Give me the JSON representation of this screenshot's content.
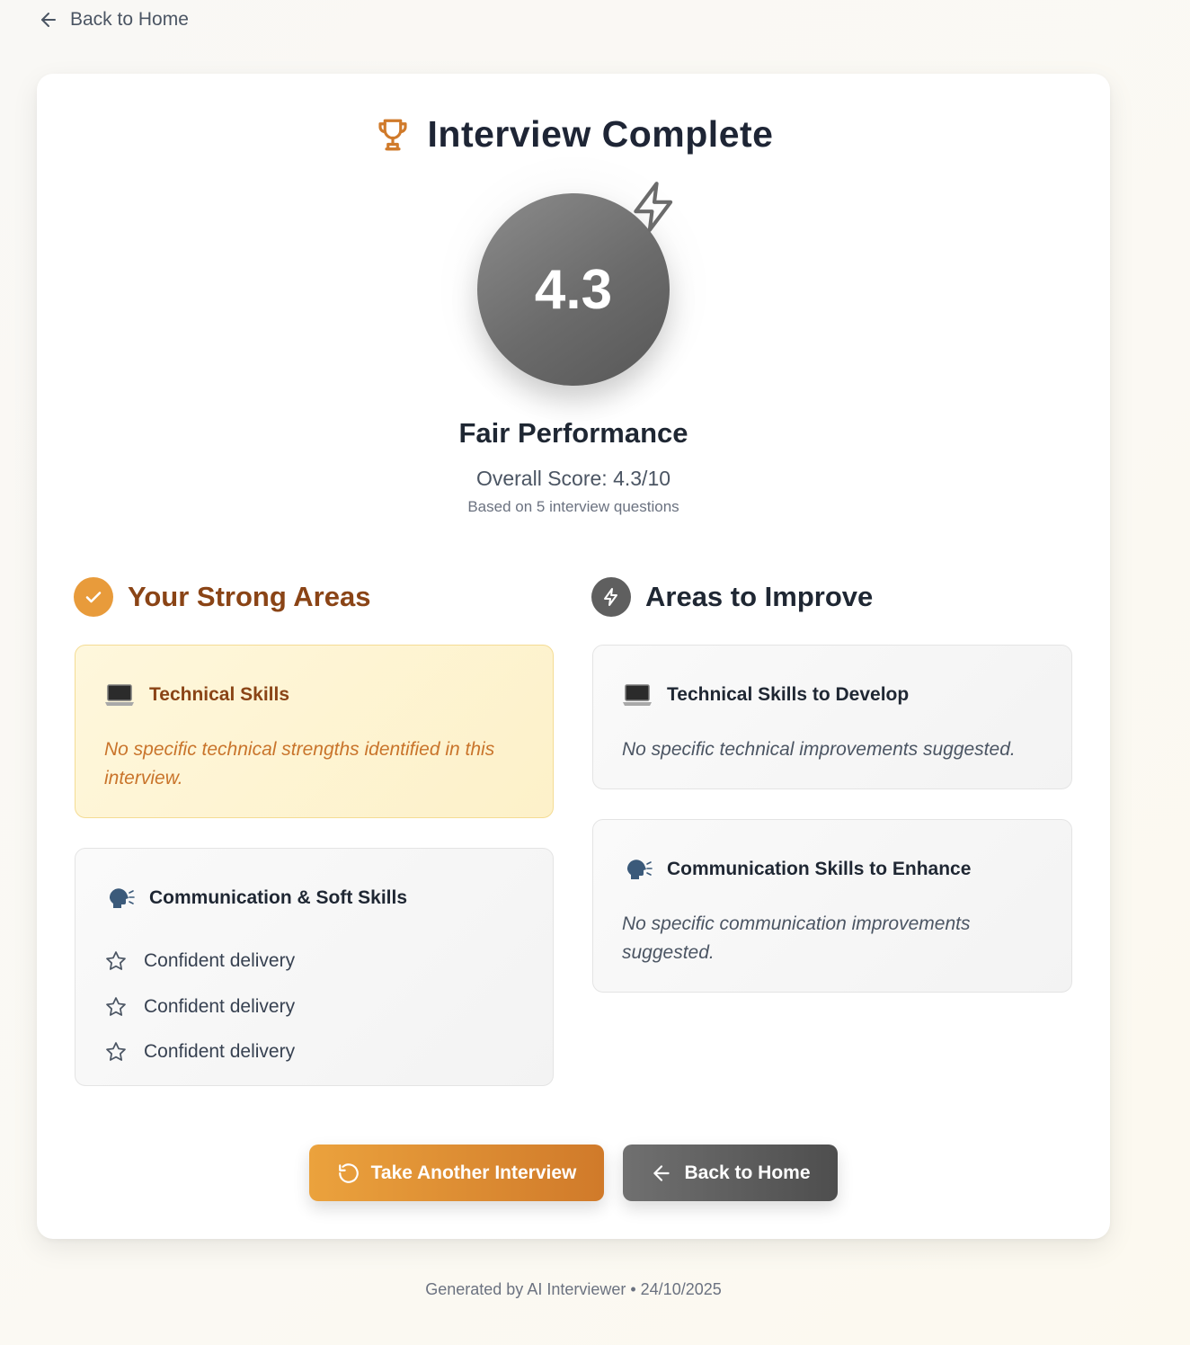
{
  "nav": {
    "back_label": "Back to Home"
  },
  "header": {
    "title": "Interview Complete"
  },
  "score": {
    "value": "4.3",
    "performance_label": "Fair Performance",
    "overall_text": "Overall Score: 4.3/10",
    "based_on_text": "Based on 5 interview questions"
  },
  "strong": {
    "heading": "Your Strong Areas",
    "technical": {
      "title": "Technical Skills",
      "text": "No specific technical strengths identified in this interview."
    },
    "communication": {
      "title": "Communication & Soft Skills",
      "items": [
        "Confident delivery",
        "Confident delivery",
        "Confident delivery"
      ]
    }
  },
  "improve": {
    "heading": "Areas to Improve",
    "technical": {
      "title": "Technical Skills to Develop",
      "text": "No specific technical improvements suggested."
    },
    "communication": {
      "title": "Communication Skills to Enhance",
      "text": "No specific communication improvements suggested."
    }
  },
  "actions": {
    "retake_label": "Take Another Interview",
    "home_label": "Back to Home"
  },
  "footer": {
    "text": "Generated by AI Interviewer • 24/10/2025"
  },
  "colors": {
    "accent": "#e89b3b",
    "accent_dark": "#8a4416",
    "neutral": "#5f5f5f",
    "score_circle": "#6b6b6b"
  },
  "icons": {
    "back": "arrow-left-icon",
    "title": "trophy-icon",
    "score_badge": "lightning-icon",
    "strong": "check-icon",
    "improve": "lightning-icon",
    "technical": "laptop-icon",
    "communication": "speaking-head-icon",
    "list_item": "star-outline-icon",
    "retake": "rotate-icon"
  }
}
